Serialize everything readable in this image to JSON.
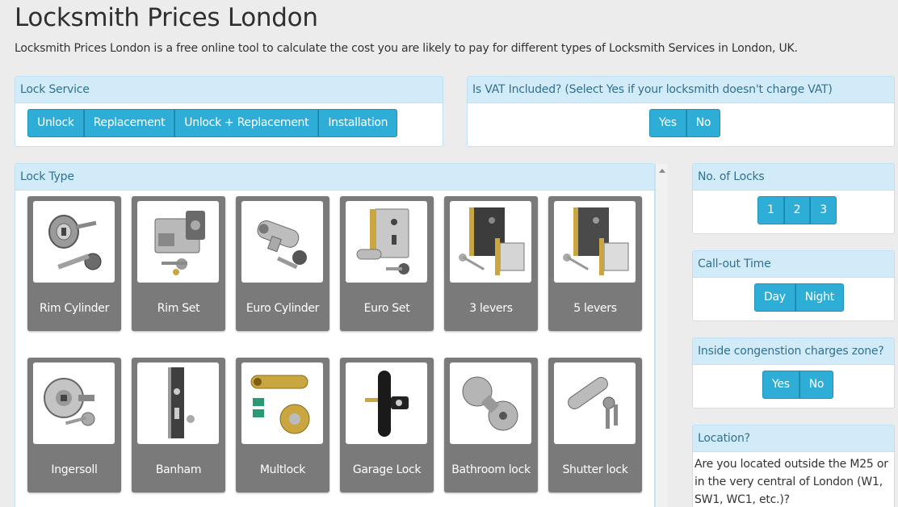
{
  "page": {
    "title": "Locksmith Prices London",
    "subtitle": "Locksmith Prices London is a free online tool to calculate the cost you are likely to pay for different types of Locksmith Services in London, UK."
  },
  "lock_service": {
    "heading": "Lock Service",
    "options": [
      "Unlock",
      "Replacement",
      "Unlock + Replacement",
      "Installation"
    ]
  },
  "vat": {
    "heading": "Is VAT Included? (Select Yes if your locksmith doesn't charge VAT)",
    "options": [
      "Yes",
      "No"
    ]
  },
  "lock_type": {
    "heading": "Lock Type",
    "items": [
      {
        "label": "Rim Cylinder",
        "icon": "rim-cylinder-lock-icon"
      },
      {
        "label": "Rim Set",
        "icon": "rim-set-lock-icon"
      },
      {
        "label": "Euro Cylinder",
        "icon": "euro-cylinder-lock-icon"
      },
      {
        "label": "Euro Set",
        "icon": "euro-set-lock-icon"
      },
      {
        "label": "3 levers",
        "icon": "mortice-3-lever-lock-icon"
      },
      {
        "label": "5 levers",
        "icon": "mortice-5-lever-lock-icon"
      },
      {
        "label": "Ingersoll",
        "icon": "ingersoll-lock-icon"
      },
      {
        "label": "Banham",
        "icon": "banham-lock-icon"
      },
      {
        "label": "Multlock",
        "icon": "multlock-lock-icon"
      },
      {
        "label": "Garage Lock",
        "icon": "garage-lock-icon"
      },
      {
        "label": "Bathroom lock",
        "icon": "bathroom-knob-lock-icon"
      },
      {
        "label": "Shutter lock",
        "icon": "shutter-lock-icon"
      }
    ]
  },
  "num_locks": {
    "heading": "No. of Locks",
    "options": [
      "1",
      "2",
      "3"
    ]
  },
  "callout": {
    "heading": "Call-out Time",
    "options": [
      "Day",
      "Night"
    ]
  },
  "congestion": {
    "heading": "Inside congenstion charges zone?",
    "options": [
      "Yes",
      "No"
    ]
  },
  "location": {
    "heading": "Location?",
    "question": " Are you located outside the M25 or in the very central of London (W1, SW1, WC1, etc.)?"
  },
  "colors": {
    "button": "#2eaed6",
    "panel_head": "#d2ebf8",
    "tile": "#7a7a7a"
  }
}
